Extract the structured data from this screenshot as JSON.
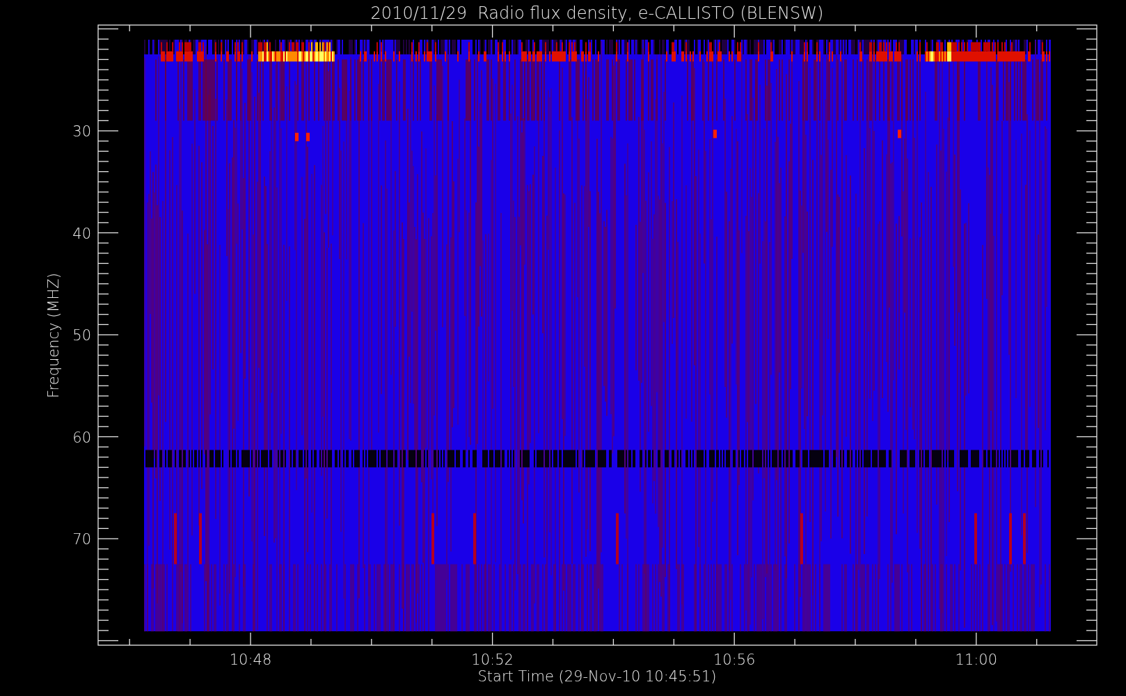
{
  "plot": {
    "title": "2010/11/29  Radio flux density, e-CALLISTO (BLENSW)",
    "ylabel": "Frequency (MHZ)",
    "xlabel": "Start Time (29-Nov-10 10:45:51)",
    "yticks": [
      "30",
      "40",
      "50",
      "60",
      "70"
    ],
    "xticks": [
      "10:48",
      "10:52",
      "10:56",
      "11:00"
    ]
  }
}
